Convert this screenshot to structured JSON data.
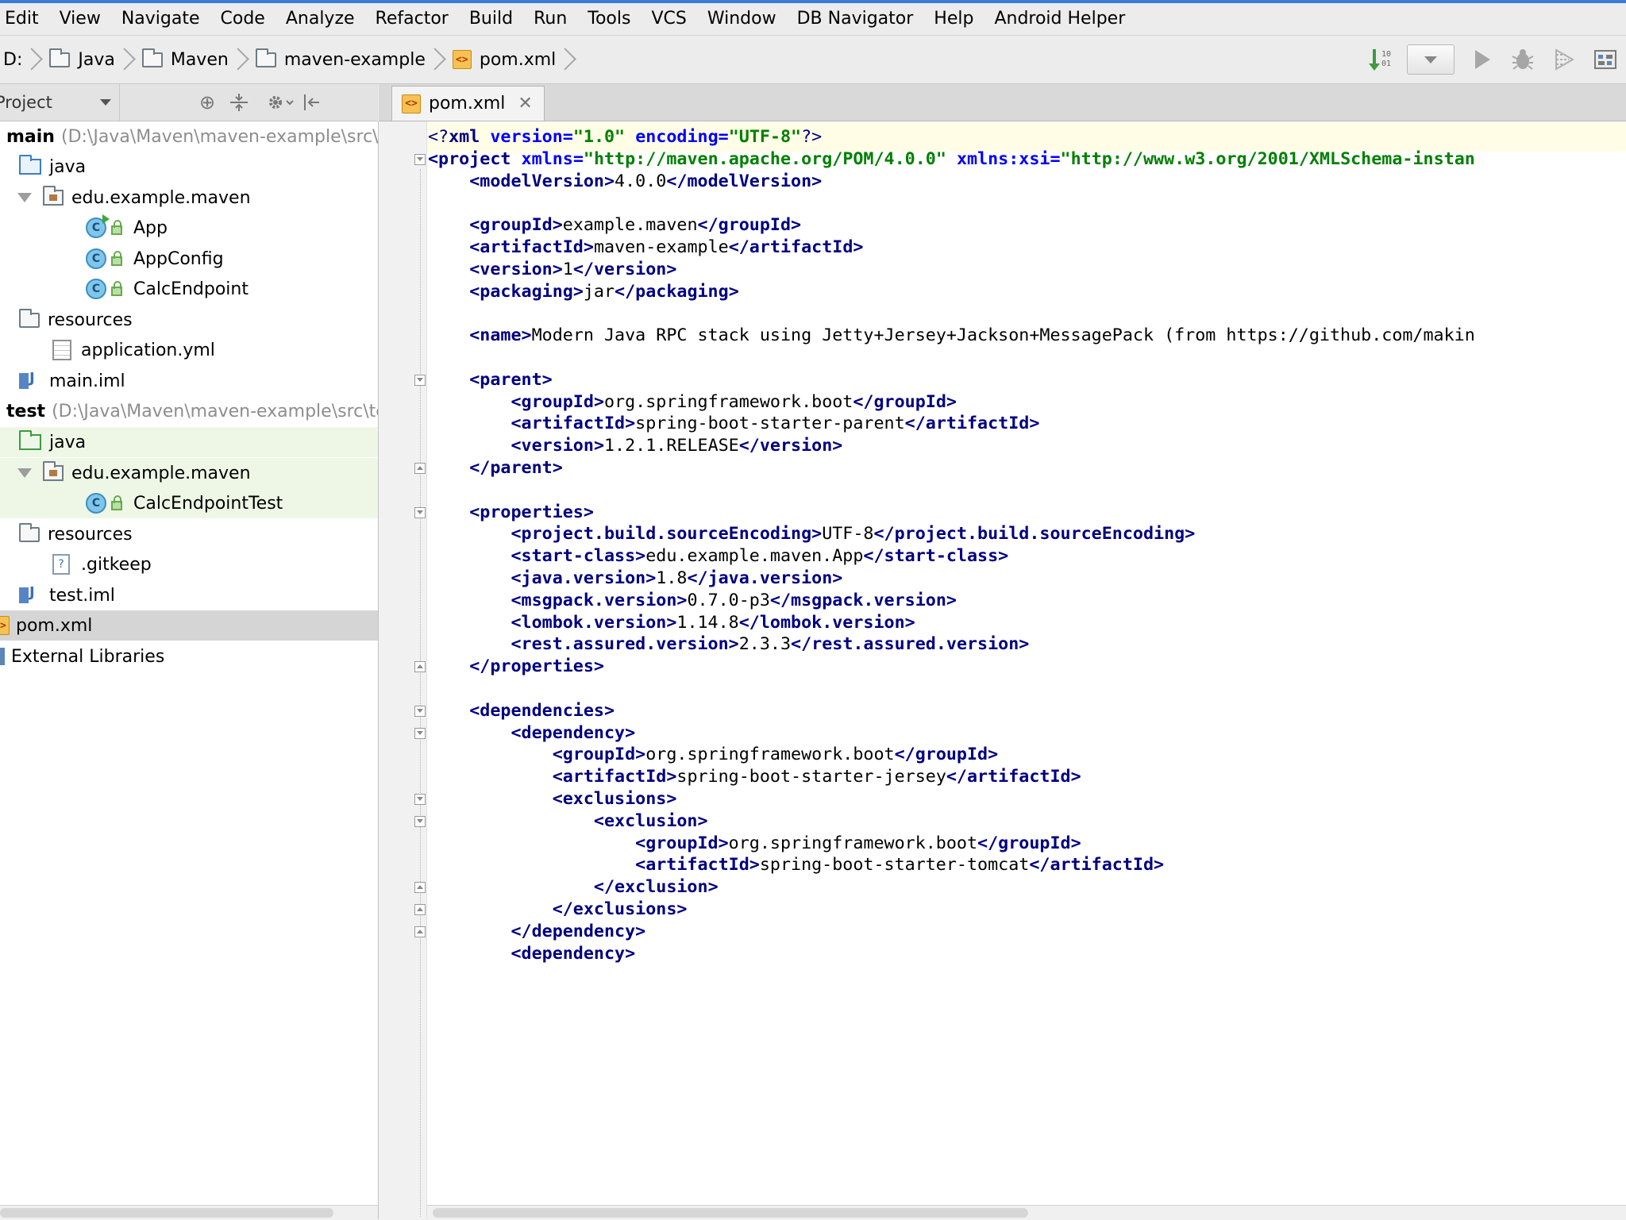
{
  "menu": [
    "Edit",
    "View",
    "Navigate",
    "Code",
    "Analyze",
    "Refactor",
    "Build",
    "Run",
    "Tools",
    "VCS",
    "Window",
    "DB Navigator",
    "Help",
    "Android Helper"
  ],
  "breadcrumb": {
    "drive": "D:",
    "items": [
      "Java",
      "Maven",
      "maven-example",
      "pom.xml"
    ]
  },
  "toolbar_icons": [
    "make-project-icon",
    "run-config-dropdown",
    "run-icon",
    "debug-icon",
    "coverage-icon",
    "project-structure-icon"
  ],
  "project_panel": {
    "title": "Project",
    "tree": [
      {
        "label": "main",
        "path": "(D:\\Java\\Maven\\maven-example\\src\\m",
        "icon": "module-icon",
        "bold": true
      },
      {
        "label": "java",
        "icon": "source-folder-icon"
      },
      {
        "label": "edu.example.maven",
        "icon": "package-icon"
      },
      {
        "label": "App",
        "icon": "class-icon"
      },
      {
        "label": "AppConfig",
        "icon": "class-icon"
      },
      {
        "label": "CalcEndpoint",
        "icon": "class-icon"
      },
      {
        "label": "resources",
        "icon": "folder-icon"
      },
      {
        "label": "application.yml",
        "icon": "yml-file-icon"
      },
      {
        "label": "main.iml",
        "icon": "iml-file-icon"
      },
      {
        "label": "test",
        "path": "(D:\\Java\\Maven\\maven-example\\src\\te",
        "icon": "module-icon",
        "bold": true
      },
      {
        "label": "java",
        "icon": "test-source-folder-icon"
      },
      {
        "label": "edu.example.maven",
        "icon": "package-icon"
      },
      {
        "label": "CalcEndpointTest",
        "icon": "class-icon"
      },
      {
        "label": "resources",
        "icon": "folder-icon"
      },
      {
        "label": ".gitkeep",
        "icon": "unknown-file-icon"
      },
      {
        "label": "test.iml",
        "icon": "iml-file-icon"
      },
      {
        "label": "pom.xml",
        "icon": "xml-file-icon"
      },
      {
        "label": "External Libraries",
        "icon": "library-icon"
      }
    ]
  },
  "editor": {
    "tab_label": "pom.xml",
    "lines": [
      "<?xml version=\"1.0\" encoding=\"UTF-8\"?>",
      "<project xmlns=\"http://maven.apache.org/POM/4.0.0\" xmlns:xsi=\"http://www.w3.org/2001/XMLSchema-instan",
      "    <modelVersion>4.0.0</modelVersion>",
      "",
      "    <groupId>example.maven</groupId>",
      "    <artifactId>maven-example</artifactId>",
      "    <version>1</version>",
      "    <packaging>jar</packaging>",
      "",
      "    <name>Modern Java RPC stack using Jetty+Jersey+Jackson+MessagePack (from https://github.com/makin",
      "",
      "    <parent>",
      "        <groupId>org.springframework.boot</groupId>",
      "        <artifactId>spring-boot-starter-parent</artifactId>",
      "        <version>1.2.1.RELEASE</version>",
      "    </parent>",
      "",
      "    <properties>",
      "        <project.build.sourceEncoding>UTF-8</project.build.sourceEncoding>",
      "        <start-class>edu.example.maven.App</start-class>",
      "        <java.version>1.8</java.version>",
      "        <msgpack.version>0.7.0-p3</msgpack.version>",
      "        <lombok.version>1.14.8</lombok.version>",
      "        <rest.assured.version>2.3.3</rest.assured.version>",
      "    </properties>",
      "",
      "    <dependencies>",
      "        <dependency>",
      "            <groupId>org.springframework.boot</groupId>",
      "            <artifactId>spring-boot-starter-jersey</artifactId>",
      "            <exclusions>",
      "                <exclusion>",
      "                    <groupId>org.springframework.boot</groupId>",
      "                    <artifactId>spring-boot-starter-tomcat</artifactId>",
      "                </exclusion>",
      "            </exclusions>",
      "        </dependency>",
      "        <dependency>"
    ]
  },
  "colors": {
    "tag": "#000080",
    "attr_name": "#0000ff",
    "attr_value": "#008000",
    "current_line": "#fffde6",
    "test_highlight": "#eef7e6",
    "selected_row": "#d5d5d5"
  }
}
